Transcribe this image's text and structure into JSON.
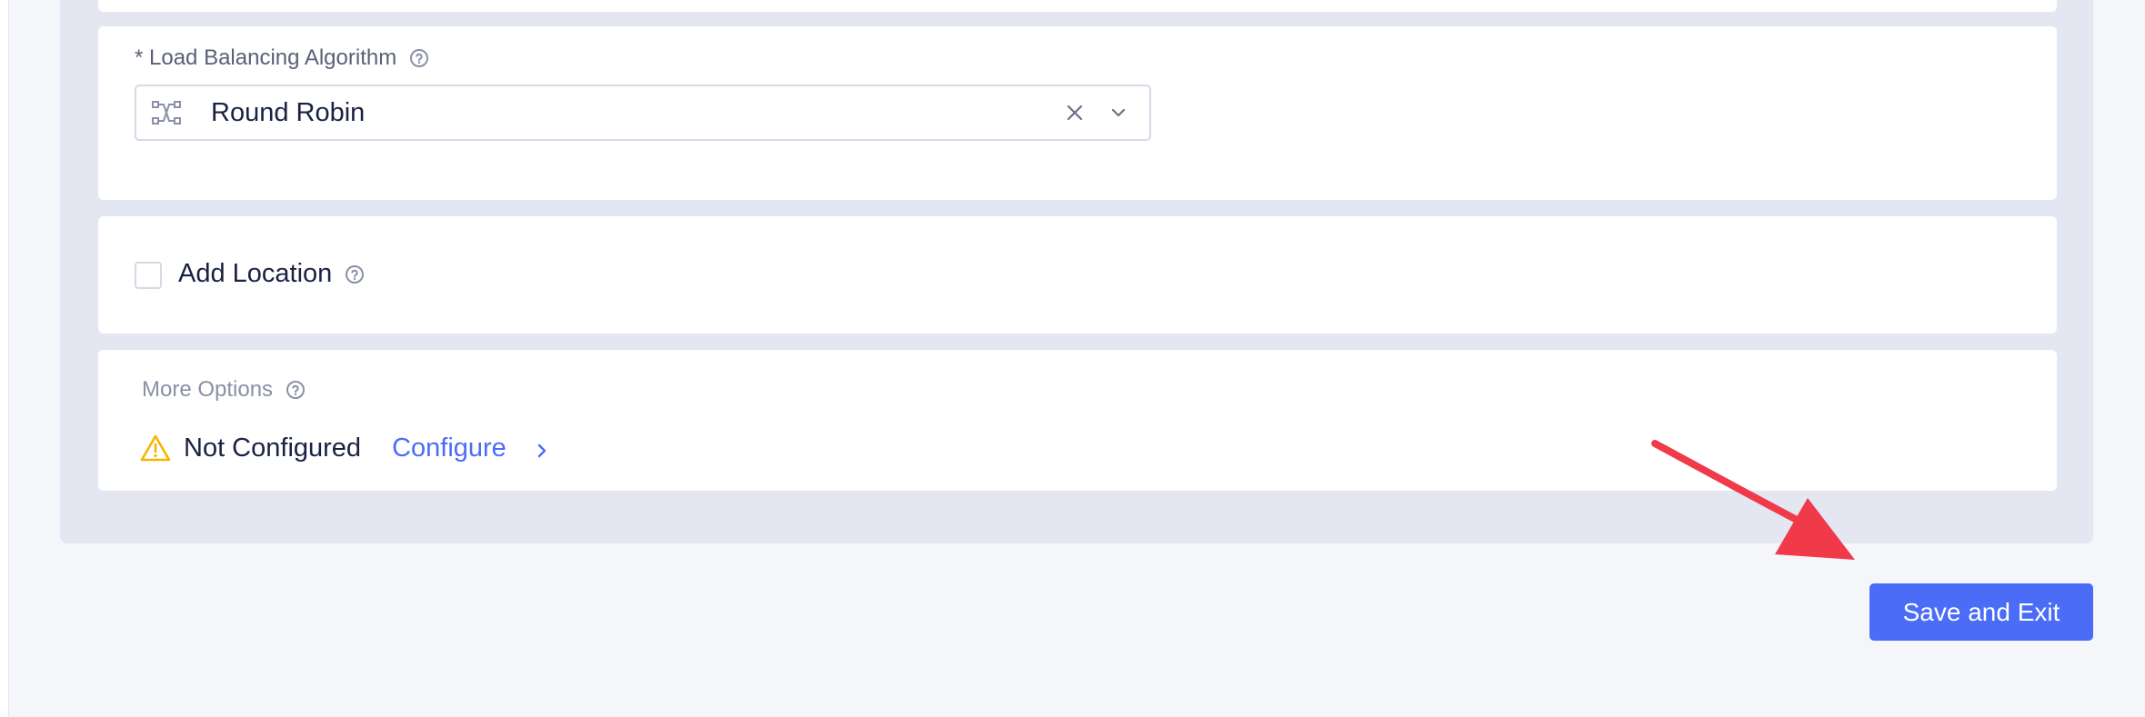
{
  "load_balancing": {
    "required_mark": "*",
    "label": "Load Balancing Algorithm",
    "selected_value": "Round Robin",
    "prefix_icon": "shuffle-icon"
  },
  "location": {
    "checkbox_label": "Add Location",
    "checked": false
  },
  "more_options": {
    "title": "More Options",
    "status_text": "Not Configured",
    "configure_label": "Configure"
  },
  "footer": {
    "save_label": "Save and Exit"
  },
  "colors": {
    "accent": "#4a6cf7",
    "warning": "#f5b400",
    "annotation_arrow": "#f03a4a",
    "panel_bg": "#e4e7f2"
  }
}
